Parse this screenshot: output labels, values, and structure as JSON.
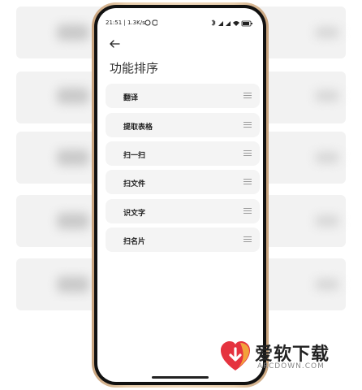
{
  "status_bar": {
    "time_speed": "21:51 | 1.3K/s",
    "icons_left": [
      "dnd-icon",
      "alarm-icon"
    ],
    "icons_right": [
      "bluetooth-icon",
      "signal-icon",
      "signal-icon",
      "wifi-icon",
      "battery-icon"
    ]
  },
  "header": {
    "back_icon": "arrow-left-icon",
    "title": "功能排序"
  },
  "functions": [
    {
      "label": "翻译"
    },
    {
      "label": "提取表格"
    },
    {
      "label": "扫一扫"
    },
    {
      "label": "扫文件"
    },
    {
      "label": "识文字"
    },
    {
      "label": "扫名片"
    }
  ],
  "watermark": {
    "title": "爱软下载",
    "subtitle": "ARCDOWN.COM",
    "colors": {
      "primary": "#e5333f",
      "secondary": "#f3a23b"
    }
  }
}
